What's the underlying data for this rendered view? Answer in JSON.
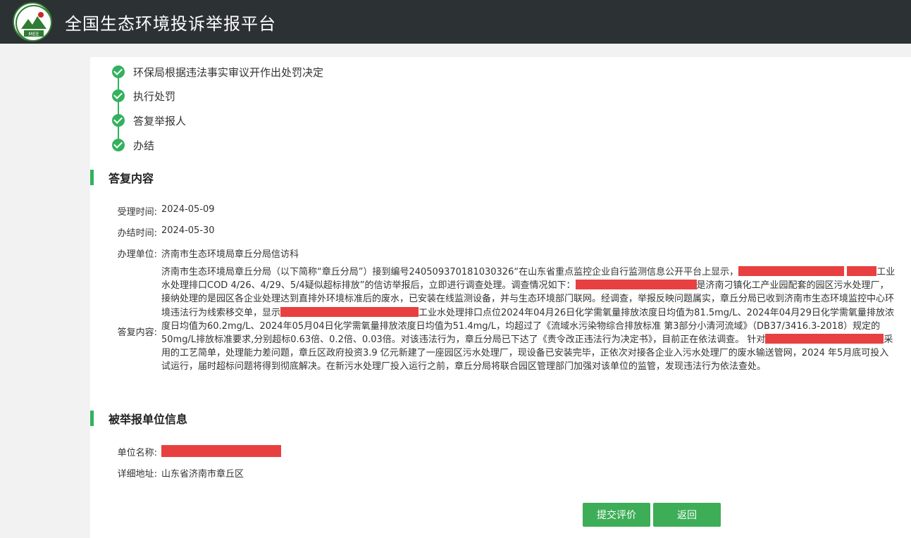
{
  "header": {
    "title": "全国生态环境投诉举报平台",
    "logo_text": "MEE"
  },
  "process_steps": [
    {
      "label": "环保局根据违法事实审议开作出处罚决定"
    },
    {
      "label": "执行处罚"
    },
    {
      "label": "答复举报人"
    },
    {
      "label": "办结"
    }
  ],
  "reply_section": {
    "title": "答复内容",
    "accept_time_label": "受理时间:",
    "accept_time": "2024-05-09",
    "finish_time_label": "办结时间:",
    "finish_time": "2024-05-30",
    "handler_label": "办理单位:",
    "handler": "济南市生态环境局章丘分局信访科",
    "content_label": "答复内容:",
    "content_parts": [
      "济南市生态环境局章丘分局（以下简称“章丘分局”）接到编号240509370181030326“在山东省重点监控企业自行监测信息公开平台上显示，",
      "工业水处理排口COD 4/26、4/29、5/4疑似超标排放”的信访举报后，立即进行调查处理。调查情况如下：",
      "是济南刁镇化工产业园配套的园区污水处理厂，接纳处理的是园区各企业处理达到直排外环境标准后的废水，已安装在线监测设备，并与生态环境部门联网。经调查，举报反映问题属实，章丘分局已收到济南市生态环境监控中心环境违法行为线索移交单，显示",
      "工业水处理排口点位2024年04月26日化学需氧量排放浓度日均值为81.5mg/L、2024年04月29日化学需氧量排放浓度日均值为60.2mg/L、2024年05月04日化学需氧量排放浓度日均值为51.4mg/L，均超过了《流域水污染物综合排放标准 第3部分小清河流域》（DB37/3416.3-2018）规定的50mg/L排放标准要求,分别超标0.63倍、0.2倍、0.03倍。对该违法行为，章丘分局已下达了《责令改正违法行为决定书》，目前正在依法调查。 针对",
      "采用的工艺简单，处理能力差问题，章丘区政府投资3.9 亿元新建了一座园区污水处理厂，现设备已安装完毕，正依次对接各企业入污水处理厂的废水输送管网，2024 年5月底可投入试运行，届时超标问题将得到彻底解决。在新污水处理厂投入运行之前，章丘分局将联合园区管理部门加强对该单位的监管，发现违法行为依法查处。"
    ]
  },
  "reported_unit_section": {
    "title": "被举报单位信息",
    "name_label": "单位名称:",
    "address_label": "详细地址:",
    "address": "山东省济南市章丘区"
  },
  "buttons": {
    "submit_rating": "提交评价",
    "back": "返回"
  },
  "colors": {
    "header_bg": "#2c3133",
    "accent_green": "#33b15f",
    "button_green": "#3dae57",
    "redaction_red": "#e84040"
  }
}
